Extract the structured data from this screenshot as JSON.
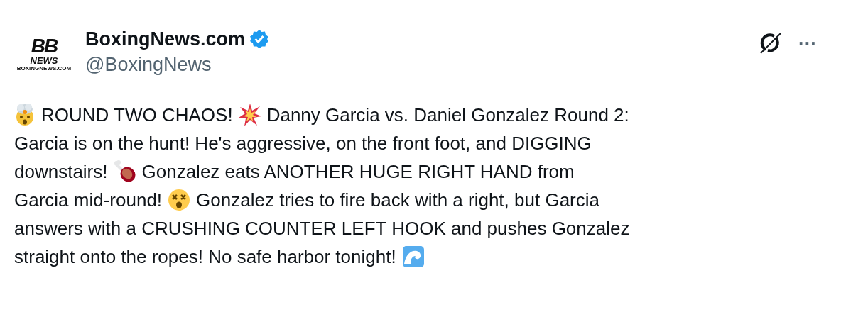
{
  "author": {
    "logo": {
      "mark": "BB",
      "word": "NEWS",
      "site": "BOXINGNEWS.COM"
    },
    "name": "BoxingNews.com",
    "verified": true,
    "handle": "@BoxingNews"
  },
  "menu_icon": "···",
  "body": {
    "lines": [
      [
        "ROUND TWO CHAOS!",
        "Danny Garcia vs. Daniel Gonzalez Round 2:"
      ],
      [
        "Garcia is on the hunt! He's aggressive, on the front foot, and DIGGING"
      ],
      [
        "downstairs!",
        "Gonzalez eats ANOTHER HUGE RIGHT HAND from"
      ],
      [
        "Garcia mid-round!",
        "Gonzalez tries to fire back with a right, but Garcia"
      ],
      [
        "answers with a CRUSHING COUNTER LEFT HOOK and pushes Gonzalez"
      ],
      [
        "straight onto the ropes! No safe harbor tonight!"
      ]
    ]
  }
}
